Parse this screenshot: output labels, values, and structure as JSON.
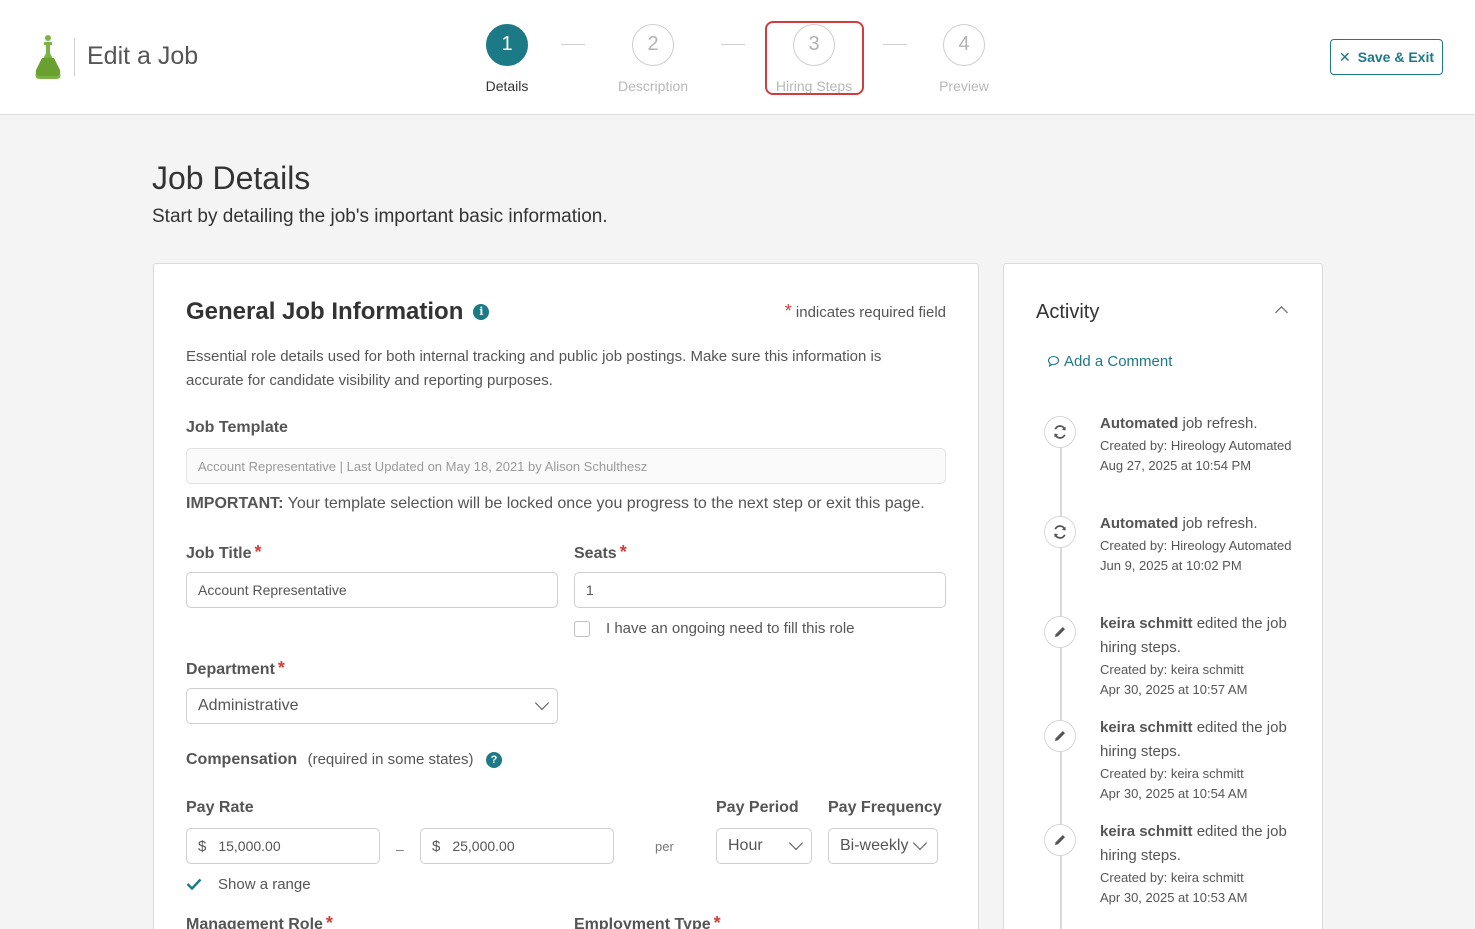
{
  "header": {
    "app_title": "Edit a Job",
    "save_exit_label": "Save & Exit",
    "brand_color": "#1c7a86",
    "steps": [
      {
        "number": "1",
        "label": "Details",
        "active": true
      },
      {
        "number": "2",
        "label": "Description",
        "active": false
      },
      {
        "number": "3",
        "label": "Hiring Steps",
        "active": false
      },
      {
        "number": "4",
        "label": "Preview",
        "active": false
      }
    ]
  },
  "page": {
    "title": "Job Details",
    "subtitle": "Start by detailing the job's important basic information."
  },
  "general": {
    "title": "General Job Information",
    "required_note": "indicates required field",
    "description": "Essential role details used for both internal tracking and public job postings. Make sure this information is accurate for candidate visibility and reporting purposes.",
    "template_label": "Job Template",
    "template_value": "Account Representative | Last Updated on May 18, 2021 by Alison Schulthesz",
    "important_bold": "IMPORTANT:",
    "important_text": " Your template selection will be locked once you progress to the next step or exit this page.",
    "job_title_label": "Job Title",
    "job_title_value": "Account Representative",
    "seats_label": "Seats",
    "seats_value": "1",
    "ongoing_label": "I have an ongoing need to fill this role",
    "department_label": "Department",
    "department_value": "Administrative",
    "compensation_label": "Compensation",
    "compensation_note": "(required in some states)",
    "pay_rate_label": "Pay Rate",
    "currency_symbol": "$",
    "pay_min": "15,000.00",
    "range_dash": "–",
    "pay_max": "25,000.00",
    "per_label": "per",
    "pay_period_label": "Pay Period",
    "pay_period_value": "Hour",
    "pay_frequency_label": "Pay Frequency",
    "pay_frequency_value": "Bi-weekly",
    "show_range_label": "Show a range",
    "management_role_label": "Management Role",
    "employment_type_label": "Employment Type"
  },
  "activity": {
    "title": "Activity",
    "add_comment": "Add a Comment",
    "items": [
      {
        "icon": "refresh-icon",
        "bold": "Automated",
        "text": " job refresh.",
        "meta1": "Created by: Hireology Automated",
        "meta2": "Aug 27, 2025 at 10:54 PM"
      },
      {
        "icon": "refresh-icon",
        "bold": "Automated",
        "text": " job refresh.",
        "meta1": "Created by: Hireology Automated",
        "meta2": "Jun 9, 2025 at 10:02 PM"
      },
      {
        "icon": "pencil-icon",
        "bold": "keira schmitt",
        "text": " edited the job hiring steps.",
        "meta1": "Created by: keira schmitt",
        "meta2": "Apr 30, 2025 at 10:57 AM"
      },
      {
        "icon": "pencil-icon",
        "bold": "keira schmitt",
        "text": " edited the job hiring steps.",
        "meta1": "Created by: keira schmitt",
        "meta2": "Apr 30, 2025 at 10:54 AM"
      },
      {
        "icon": "pencil-icon",
        "bold": "keira schmitt",
        "text": " edited the job hiring steps.",
        "meta1": "Created by: keira schmitt",
        "meta2": "Apr 30, 2025 at 10:53 AM"
      }
    ]
  }
}
